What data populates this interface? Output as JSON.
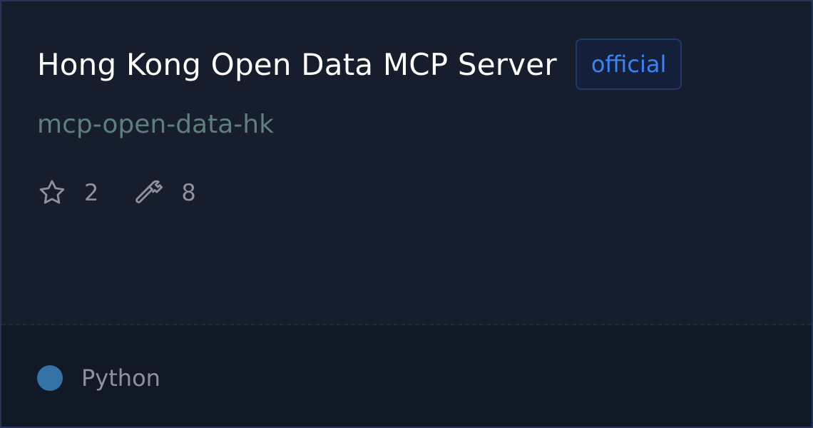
{
  "card": {
    "title": "Hong Kong Open Data MCP Server",
    "badge": "official",
    "slug": "mcp-open-data-hk",
    "stats": {
      "stars_icon": "star-icon",
      "stars": "2",
      "tools_icon": "hammer-icon",
      "tools": "8"
    },
    "language": {
      "name": "Python",
      "color": "#3572a5"
    }
  }
}
